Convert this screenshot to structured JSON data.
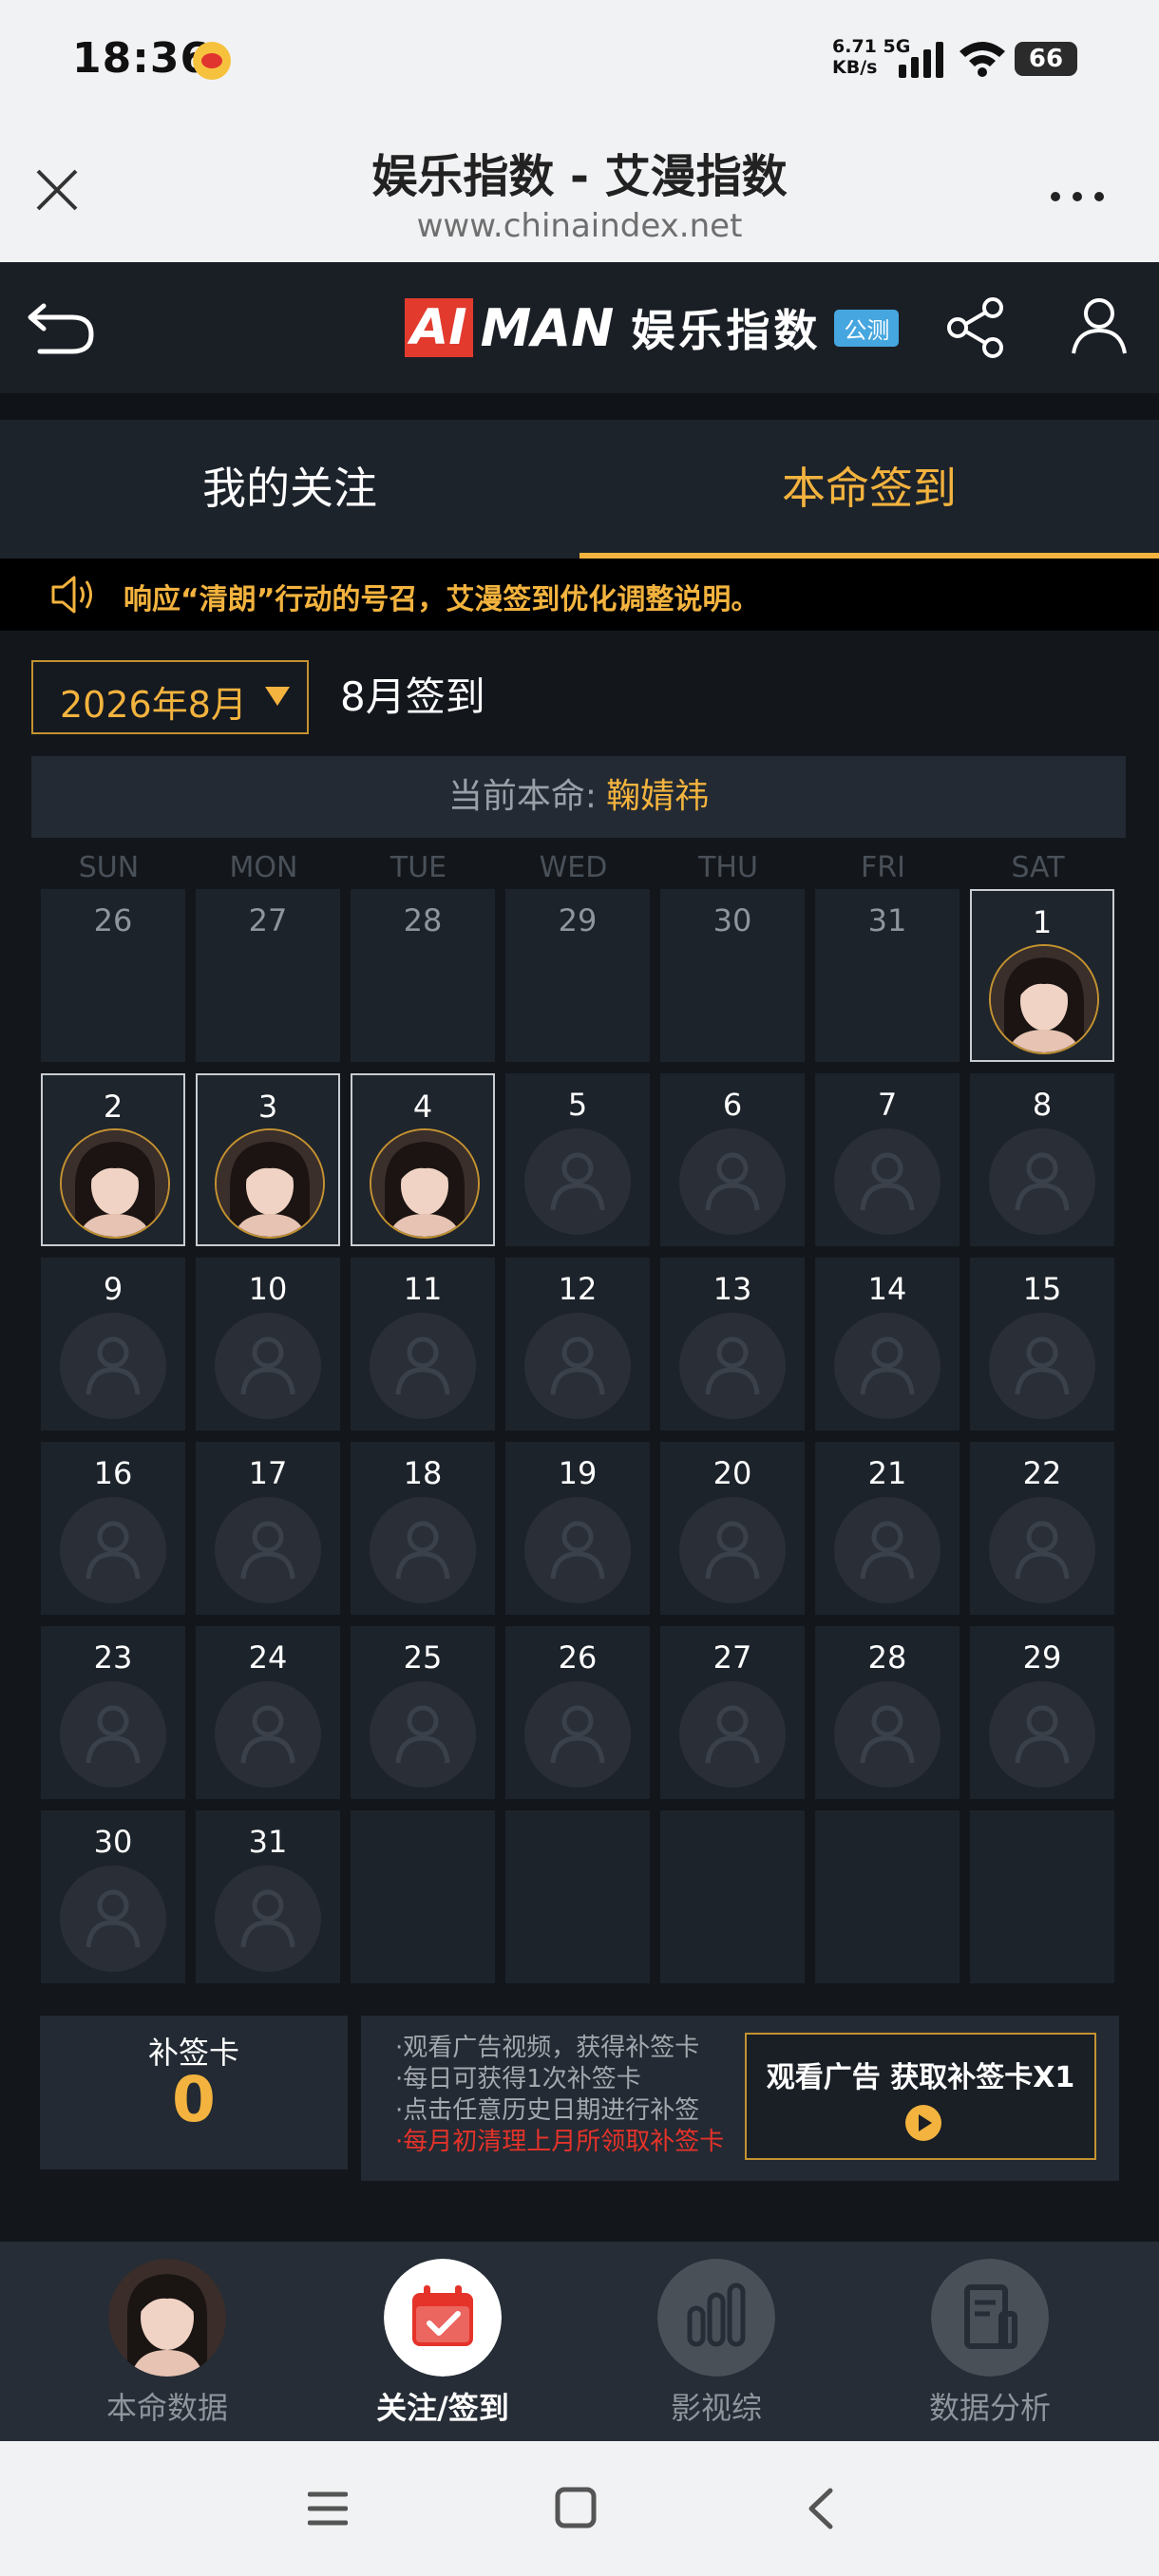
{
  "status_bar": {
    "time": "18:36",
    "net_speed": "6.71",
    "net_unit": "KB/s",
    "net_type": "5G",
    "battery": "66"
  },
  "browser": {
    "title": "娱乐指数 - 艾漫指数",
    "url": "www.chinaindex.net"
  },
  "app_header": {
    "logo_ai": "AI",
    "logo_man": "MAN",
    "logo_text": "娱乐指数",
    "beta_badge": "公测"
  },
  "tabs": {
    "my_follow": "我的关注",
    "checkin": "本命签到"
  },
  "notice": {
    "text": "响应“清朗”行动的号召，艾漫签到优化调整说明。"
  },
  "calendar": {
    "month_select": "2026年8月",
    "title": "8月签到",
    "current_label": "当前本命:",
    "current_name": "鞠婧祎",
    "weekdays": [
      "SUN",
      "MON",
      "TUE",
      "WED",
      "THU",
      "FRI",
      "SAT"
    ],
    "prev_days": [
      "26",
      "27",
      "28",
      "29",
      "30",
      "31"
    ],
    "checked_days": [
      "1",
      "2",
      "3",
      "4"
    ]
  },
  "makeup_card": {
    "label": "补签卡",
    "count": "0"
  },
  "tips": {
    "line1": "·观看广告视频，获得补签卡",
    "line2": "·每日可获得1次补签卡",
    "line3": "·点击任意历史日期进行补签",
    "line4": "·每月初清理上月所领取补签卡"
  },
  "ad_button": {
    "label": "观看广告 获取补签卡X1"
  },
  "bottom_nav": {
    "item1": "本命数据",
    "item2": "关注/签到",
    "item3": "影视综",
    "item4": "数据分析"
  },
  "colors": {
    "accent": "#f3b33e",
    "red": "#e5332a",
    "bg": "#13171c",
    "cell": "#1d232b"
  }
}
